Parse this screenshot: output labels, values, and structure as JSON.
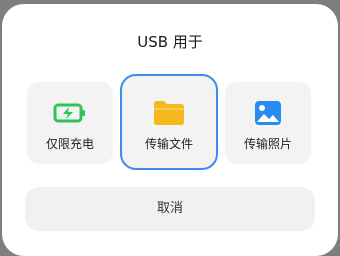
{
  "dialog": {
    "title": "USB 用于",
    "options": [
      {
        "label": "仅限充电",
        "icon": "battery-charging-icon",
        "selected": false
      },
      {
        "label": "传输文件",
        "icon": "folder-icon",
        "selected": true
      },
      {
        "label": "传输照片",
        "icon": "image-icon",
        "selected": false
      }
    ],
    "cancel_label": "取消"
  },
  "colors": {
    "accent": "#3d8ee6",
    "battery_green": "#2fc35a",
    "folder_yellow": "#f6b81c",
    "image_blue": "#2a8cf0"
  }
}
